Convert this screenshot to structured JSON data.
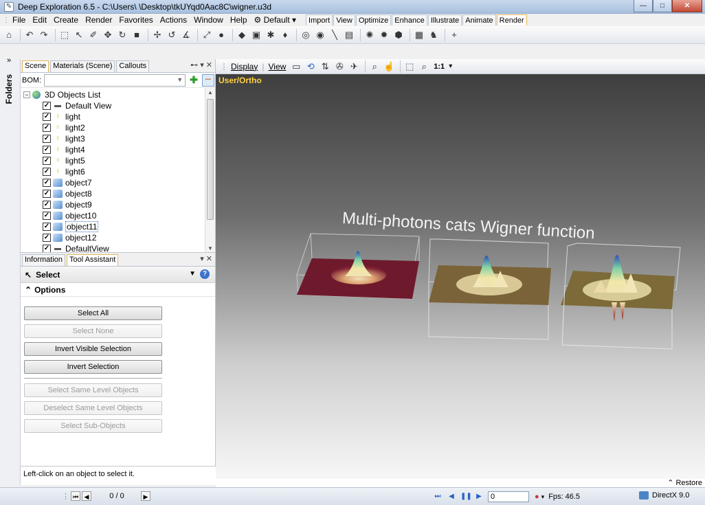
{
  "window": {
    "title": "Deep Exploration 6.5 - C:\\Users\\        \\Desktop\\tkUYqd0Aac8C\\wigner.u3d",
    "controls": [
      "minimize",
      "maximize",
      "close"
    ]
  },
  "menu": {
    "items": [
      "File",
      "Edit",
      "Create",
      "Render",
      "Favorites",
      "Actions",
      "Window",
      "Help"
    ],
    "preset": "Default",
    "ribbon_tabs": [
      "Import",
      "View",
      "Optimize",
      "Enhance",
      "Illustrate",
      "Animate",
      "Render"
    ],
    "active_ribbon_tab": "Render"
  },
  "left_strip": {
    "label": "Folders"
  },
  "scene_panel": {
    "tabs": [
      "Scene",
      "Materials (Scene)",
      "Callouts"
    ],
    "active_tab": "Scene",
    "bom_label": "BOM:",
    "bom_value": "",
    "tree": {
      "root": "3D Objects List",
      "items": [
        {
          "label": "Default View",
          "icon": "camera-icon"
        },
        {
          "label": "light",
          "icon": "bulb-icon"
        },
        {
          "label": "light2",
          "icon": "bulb-icon"
        },
        {
          "label": "light3",
          "icon": "bulb-icon"
        },
        {
          "label": "light4",
          "icon": "bulb-icon"
        },
        {
          "label": "light5",
          "icon": "bulb-icon"
        },
        {
          "label": "light6",
          "icon": "bulb-icon"
        },
        {
          "label": "object7",
          "icon": "cube-icon"
        },
        {
          "label": "object8",
          "icon": "cube-icon"
        },
        {
          "label": "object9",
          "icon": "cube-icon"
        },
        {
          "label": "object10",
          "icon": "cube-icon"
        },
        {
          "label": "object11",
          "icon": "cube-icon"
        },
        {
          "label": "object12",
          "icon": "cube-icon"
        },
        {
          "label": "DefaultView",
          "icon": "camera-icon"
        }
      ],
      "selected": "object11"
    }
  },
  "tool_panel": {
    "tabs": [
      "Information",
      "Tool Assistant"
    ],
    "active_tab": "Tool Assistant",
    "tool_name": "Select",
    "options_label": "Options",
    "buttons": [
      {
        "label": "Select All",
        "enabled": true
      },
      {
        "label": "Select None",
        "enabled": false
      },
      {
        "label": "Invert Visible Selection",
        "enabled": true
      },
      {
        "label": "Invert Selection",
        "enabled": true
      },
      {
        "label": "Select Same Level Objects",
        "enabled": false
      },
      {
        "label": "Deselect Same Level Objects",
        "enabled": false
      },
      {
        "label": "Select Sub-Objects",
        "enabled": false
      }
    ],
    "hint": "Left-click on an object to select it."
  },
  "viewport": {
    "menu": [
      "Display",
      "View"
    ],
    "zoom_label": "1:1",
    "camera_label": "User/Ortho",
    "scene_title": "Multi-photons cats Wigner function",
    "restore_label": "Restore"
  },
  "status": {
    "page": "0 / 0",
    "frame": "0",
    "fps": "Fps: 46.5",
    "renderer": "DirectX 9.0"
  },
  "colors": {
    "camera_label": "#ffd23f",
    "active_tab_border": "#e2b65a",
    "plate_1": "#6e1a2c",
    "plate_2": "#7a6338",
    "plate_3": "#7c6a38"
  }
}
